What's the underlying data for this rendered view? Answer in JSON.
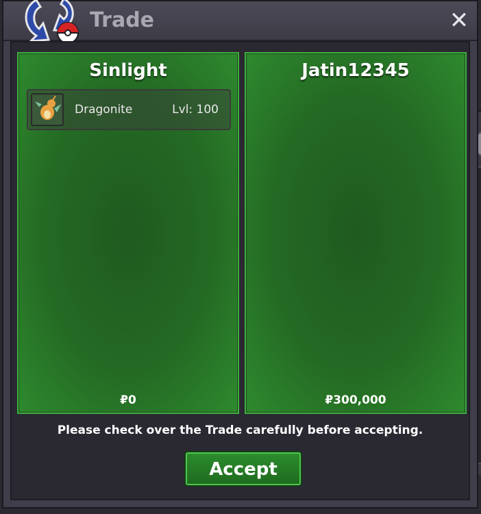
{
  "window": {
    "title": "Trade",
    "close_glyph": "✕"
  },
  "trade": {
    "left": {
      "player": "Sinlight",
      "items": [
        {
          "name": "Dragonite",
          "level": "Lvl: 100",
          "icon": "dragonite-icon"
        }
      ],
      "money": "₽0"
    },
    "right": {
      "player": "Jatin12345",
      "items": [],
      "money": "₽300,000"
    }
  },
  "footer": {
    "note": "Please check over the Trade carefully before accepting.",
    "accept_label": "Accept"
  },
  "colors": {
    "panel_green": "#2e8a2e",
    "accept_green": "#2c8c2c",
    "window_bg": "#3f3e4a"
  }
}
